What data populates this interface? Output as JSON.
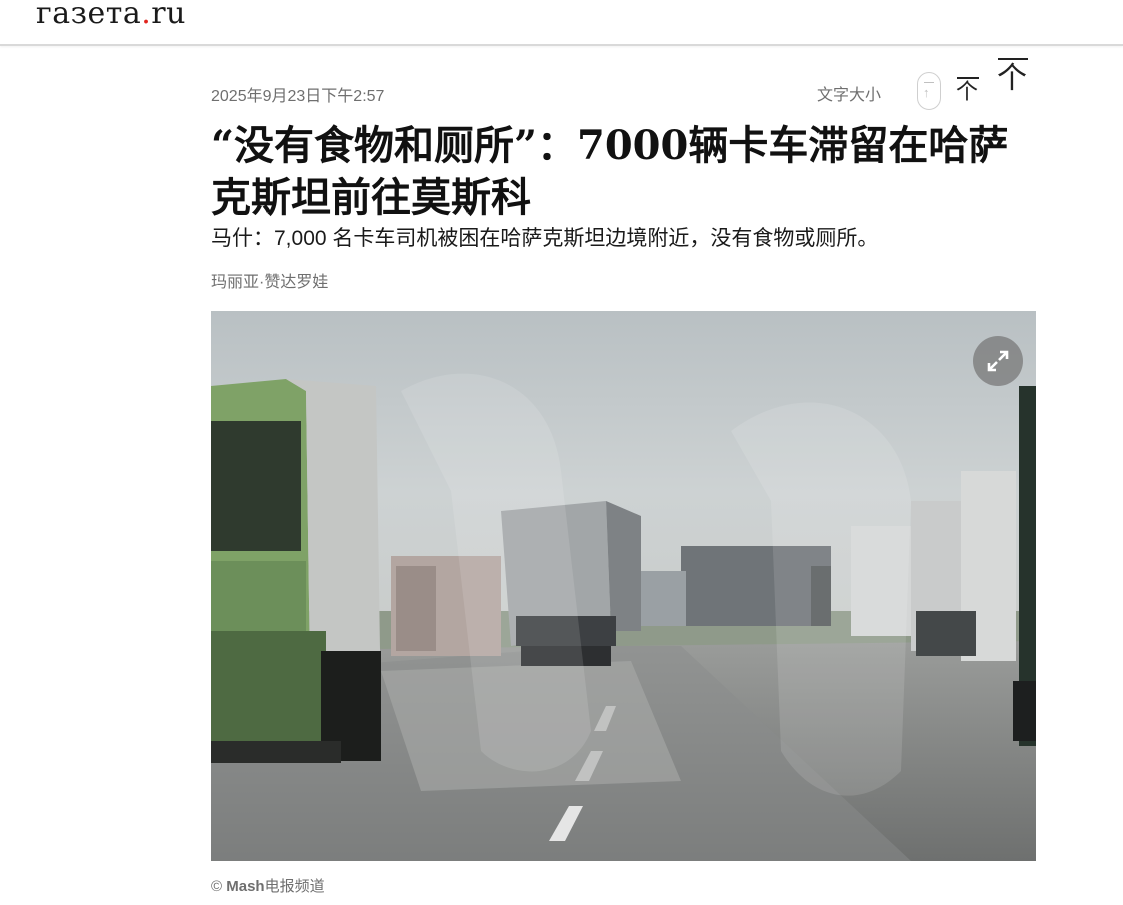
{
  "site": {
    "logo_main": "газета",
    "logo_dot": ".",
    "logo_tld": "ru"
  },
  "article": {
    "date": "2025年9月23日下午2:57",
    "font_size_label": "文字大小",
    "title": "“没有食物和厕所”：7000辆卡车滞留在哈萨克斯坦前往莫斯科",
    "lede": "马什：7,000 名卡车司机被困在哈萨克斯坦边境附近，没有食物或厕所。",
    "author": "玛丽亚·赞达罗娃",
    "photo_credit_prefix": "©",
    "photo_credit_source": "Mash",
    "photo_credit_suffix": "电报频道"
  },
  "colors": {
    "accent": "#e1241d",
    "meta_gray": "#6f6f6f"
  },
  "icons": {
    "expand": "expand-icon",
    "font_small": "font-size-small-icon",
    "font_medium": "font-size-medium-icon",
    "font_large": "font-size-large-icon"
  }
}
